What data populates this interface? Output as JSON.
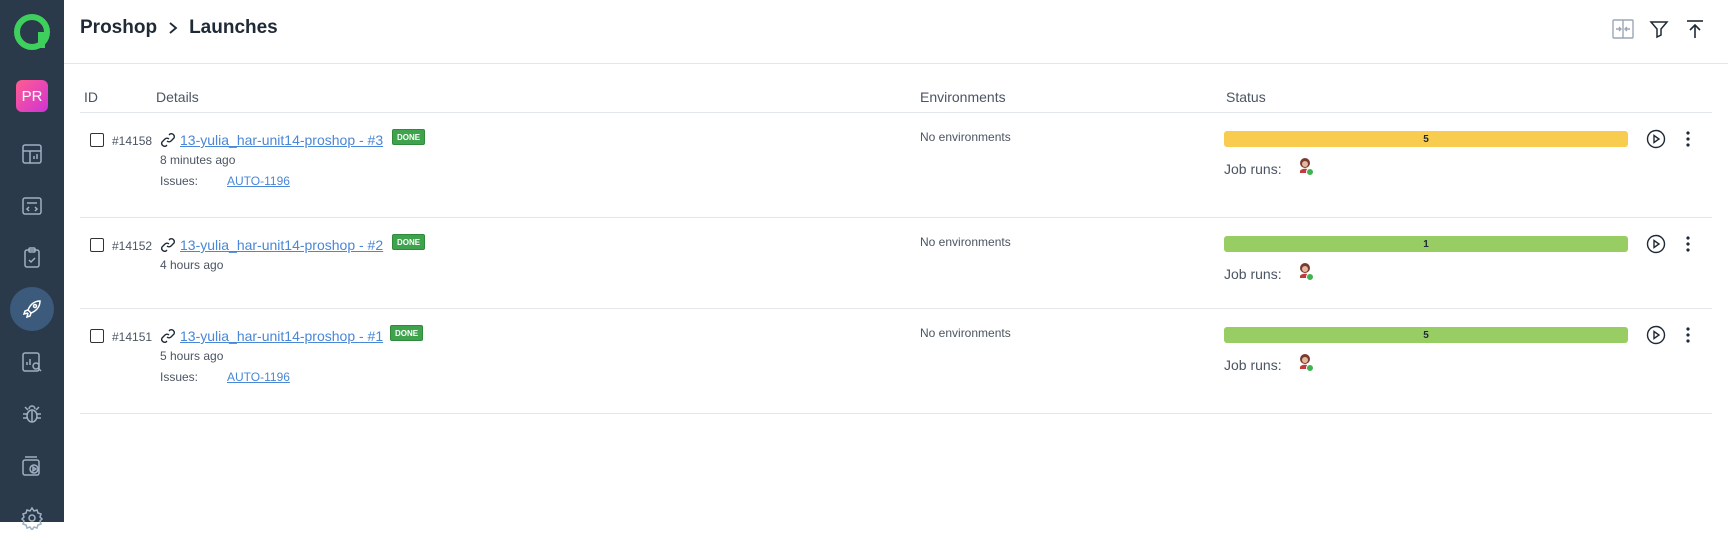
{
  "sidebar": {
    "project_badge": "PR",
    "icons": [
      "dashboard-icon",
      "test-cases-icon",
      "test-plans-icon",
      "launches-icon",
      "analytics-icon",
      "defects-icon",
      "jobs-icon",
      "settings-icon"
    ],
    "accent": "#3ecf5c"
  },
  "header": {
    "breadcrumb_project": "Proshop",
    "breadcrumb_page": "Launches"
  },
  "table": {
    "columns": {
      "id": "ID",
      "details": "Details",
      "environments": "Environments",
      "status": "Status"
    },
    "rows": [
      {
        "id": "#14158",
        "name": "13-yulia_har-unit14-proshop - #3",
        "badge": "DONE",
        "ago": "8 minutes ago",
        "issues_label": "Issues:",
        "issue": "AUTO-1196",
        "environment": "No environments",
        "status_count": "5",
        "status_color": "#f7cc4f",
        "job_runs_label": "Job runs:"
      },
      {
        "id": "#14152",
        "name": "13-yulia_har-unit14-proshop - #2",
        "badge": "DONE",
        "ago": "4 hours ago",
        "environment": "No environments",
        "status_count": "1",
        "status_color": "#97cd63",
        "job_runs_label": "Job runs:"
      },
      {
        "id": "#14151",
        "name": "13-yulia_har-unit14-proshop - #1",
        "badge": "DONE",
        "ago": "5 hours ago",
        "issues_label": "Issues:",
        "issue": "AUTO-1196",
        "environment": "No environments",
        "status_count": "5",
        "status_color": "#97cd63",
        "job_runs_label": "Job runs:"
      }
    ]
  }
}
